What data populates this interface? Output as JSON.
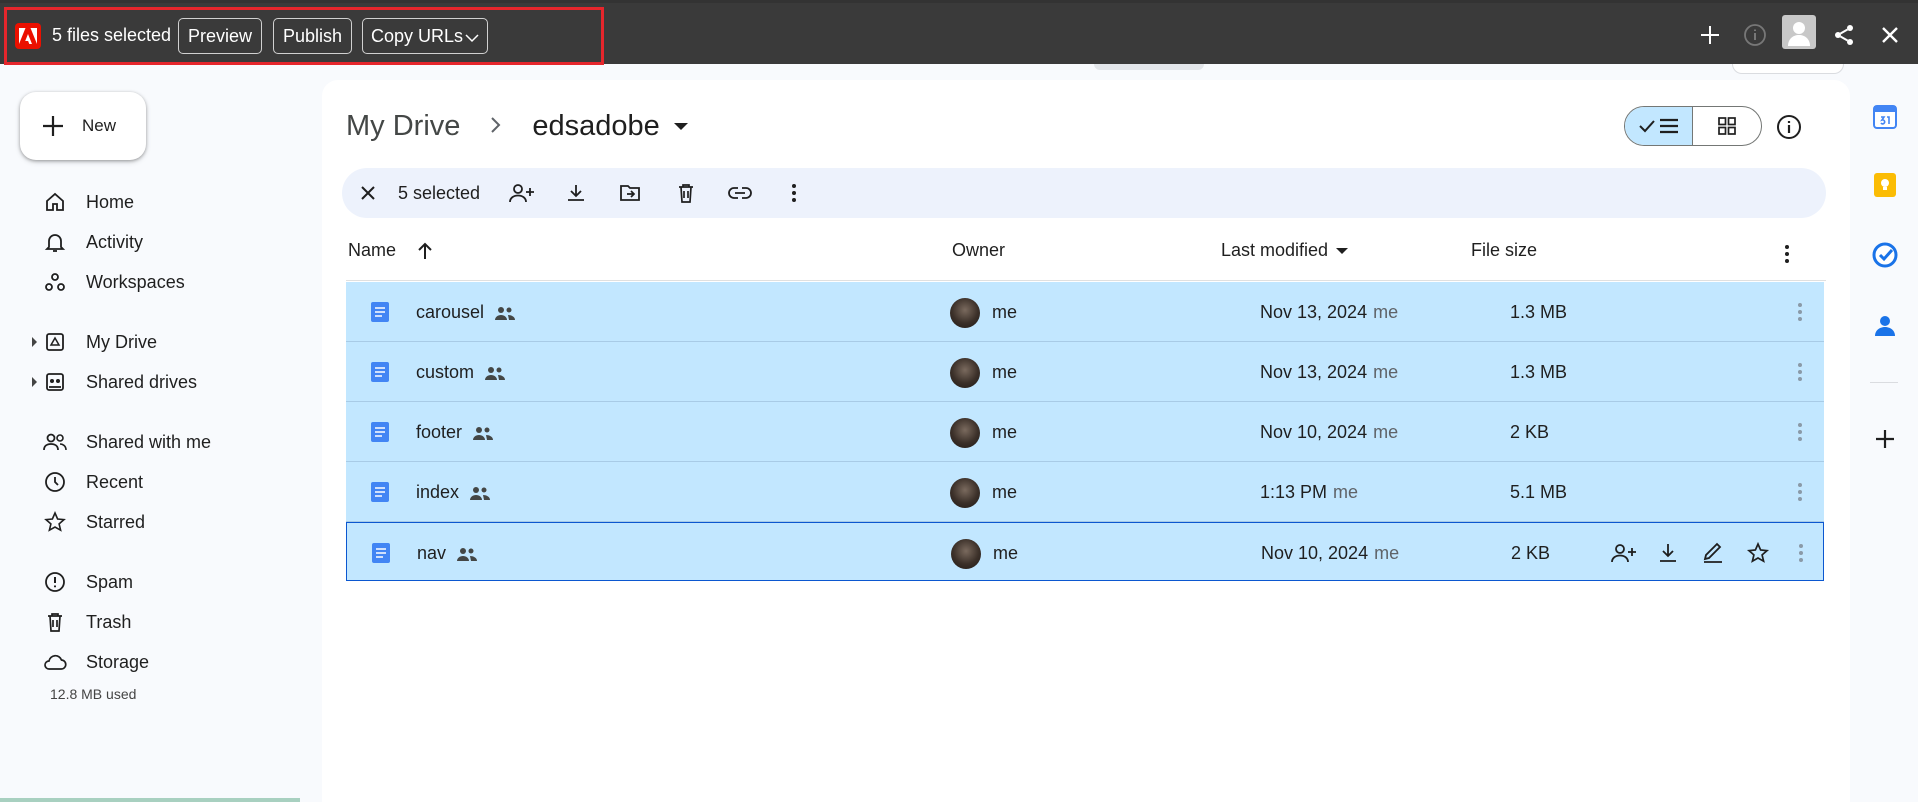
{
  "extension_bar": {
    "selection_text": "5 files selected",
    "preview_label": "Preview",
    "publish_label": "Publish",
    "copy_urls_label": "Copy URLs"
  },
  "sidebar": {
    "new_label": "New",
    "items": [
      {
        "label": "Home",
        "icon": "home-icon"
      },
      {
        "label": "Activity",
        "icon": "bell-icon"
      },
      {
        "label": "Workspaces",
        "icon": "workspaces-icon"
      },
      {
        "label": "My Drive",
        "icon": "my-drive-icon"
      },
      {
        "label": "Shared drives",
        "icon": "shared-drives-icon"
      },
      {
        "label": "Shared with me",
        "icon": "people-icon"
      },
      {
        "label": "Recent",
        "icon": "clock-icon"
      },
      {
        "label": "Starred",
        "icon": "star-icon"
      },
      {
        "label": "Spam",
        "icon": "spam-icon"
      },
      {
        "label": "Trash",
        "icon": "trash-icon"
      },
      {
        "label": "Storage",
        "icon": "cloud-icon"
      }
    ],
    "storage_used": "12.8 MB used"
  },
  "breadcrumb": {
    "root": "My Drive",
    "current": "edsadobe"
  },
  "selection_toolbar": {
    "count_label": "5 selected"
  },
  "table": {
    "headers": {
      "name": "Name",
      "owner": "Owner",
      "modified": "Last modified",
      "size": "File size"
    },
    "rows": [
      {
        "name": "carousel",
        "owner": "me",
        "modified": "Nov 13, 2024",
        "modifier": "me",
        "size": "1.3 MB"
      },
      {
        "name": "custom",
        "owner": "me",
        "modified": "Nov 13, 2024",
        "modifier": "me",
        "size": "1.3 MB"
      },
      {
        "name": "footer",
        "owner": "me",
        "modified": "Nov 10, 2024",
        "modifier": "me",
        "size": "2 KB"
      },
      {
        "name": "index",
        "owner": "me",
        "modified": "1:13 PM",
        "modifier": "me",
        "size": "5.1 MB"
      },
      {
        "name": "nav",
        "owner": "me",
        "modified": "Nov 10, 2024",
        "modifier": "me",
        "size": "2 KB"
      }
    ]
  },
  "colors": {
    "selected_row": "#c2e7ff",
    "accent": "#0b57d0",
    "adobe_red": "#eb1000",
    "highlight_box": "#e5262c"
  }
}
